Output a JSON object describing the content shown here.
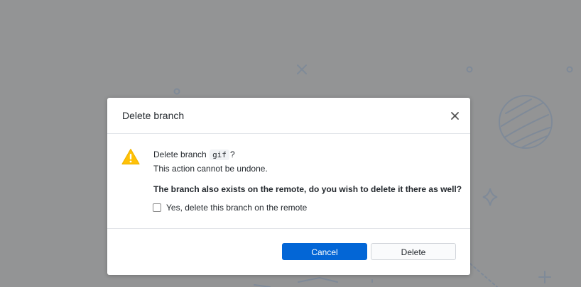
{
  "dialog": {
    "title": "Delete branch",
    "close_icon": "close-icon",
    "message_prefix": "Delete branch",
    "branch_name": "gif",
    "message_suffix": "?",
    "undo_warning": "This action cannot be undone.",
    "remote_question": "The branch also exists on the remote, do you wish to delete it there as well?",
    "remote_checkbox": {
      "label": "Yes, delete this branch on the remote",
      "checked": false
    },
    "warning_icon": "warning-icon"
  },
  "buttons": {
    "cancel_label": "Cancel",
    "delete_label": "Delete"
  },
  "colors": {
    "backdrop": "#939495",
    "primary": "#0366d6",
    "warning": "#ffd33d"
  }
}
